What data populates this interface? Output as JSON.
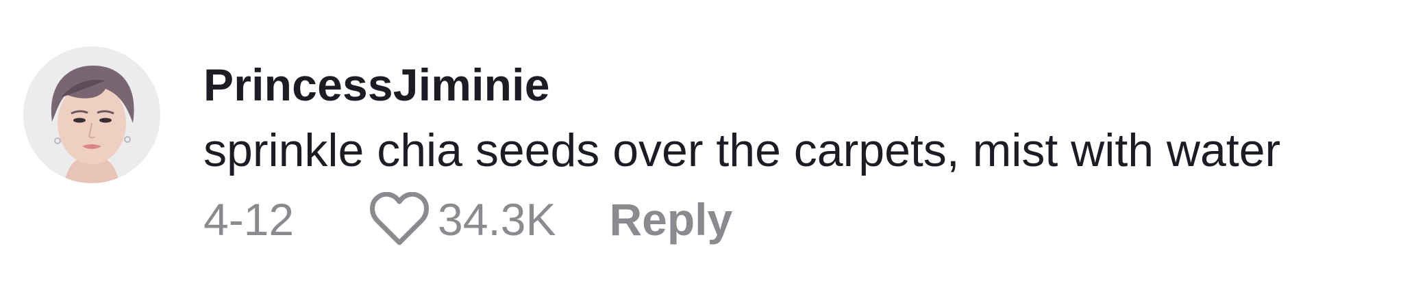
{
  "comment": {
    "username": "PrincessJiminie",
    "text": "sprinkle chia seeds over the carpets, mist with water",
    "date": "4-12",
    "likes": "34.3K",
    "reply_label": "Reply",
    "avatar_icon": "user-avatar-photo",
    "like_icon": "heart-outline-icon"
  },
  "colors": {
    "text_primary": "#1c1c24",
    "text_secondary": "#8a8a8f",
    "background": "#ffffff"
  }
}
